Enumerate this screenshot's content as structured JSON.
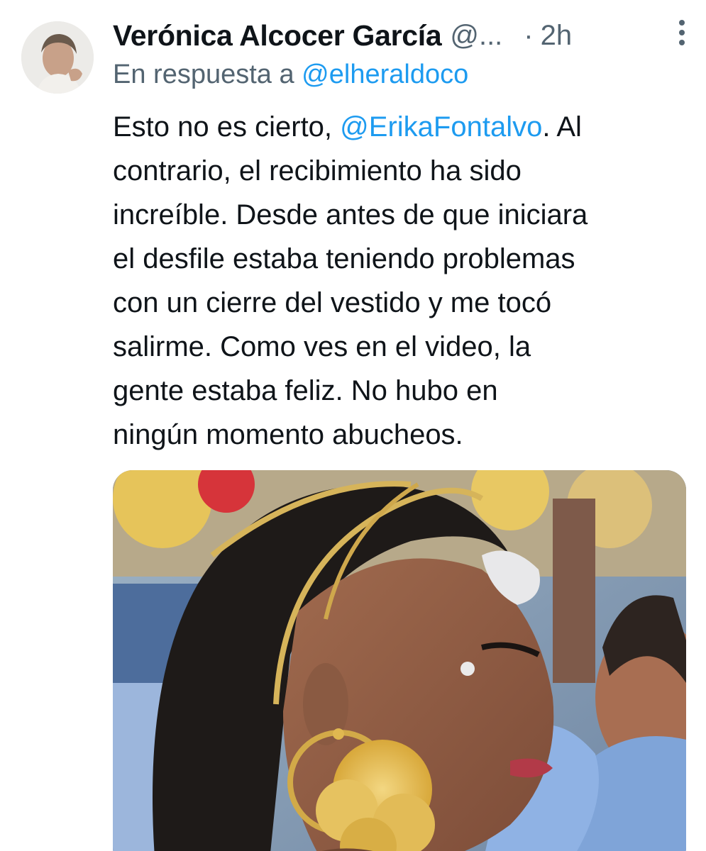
{
  "tweet": {
    "author_name": "Verónica Alcocer García",
    "author_handle": "@...",
    "separator": "·",
    "time": "2h",
    "reply_prefix": "En respuesta a",
    "reply_to": "@elheraldoco",
    "body": {
      "line1_prefix": "Esto no es cierto,",
      "line1_mention": "@ErikaFontalvo",
      "line1_suffix": ". Al",
      "lines": [
        "contrario, el recibimiento ha sido",
        "increíble. Desde antes de que iniciara",
        "el desfile estaba teniendo problemas",
        "con un cierre del vestido y me tocó",
        "salirme. Como ves en el video, la",
        "gente estaba feliz. No hubo en",
        "ningún momento abucheos."
      ]
    },
    "icons": {
      "avatar": "profile-photo",
      "more": "more-vertical-icon",
      "media": "video-thumbnail"
    },
    "colors": {
      "text": "#0f1419",
      "secondary": "#536471",
      "link": "#1d9bf0"
    }
  }
}
